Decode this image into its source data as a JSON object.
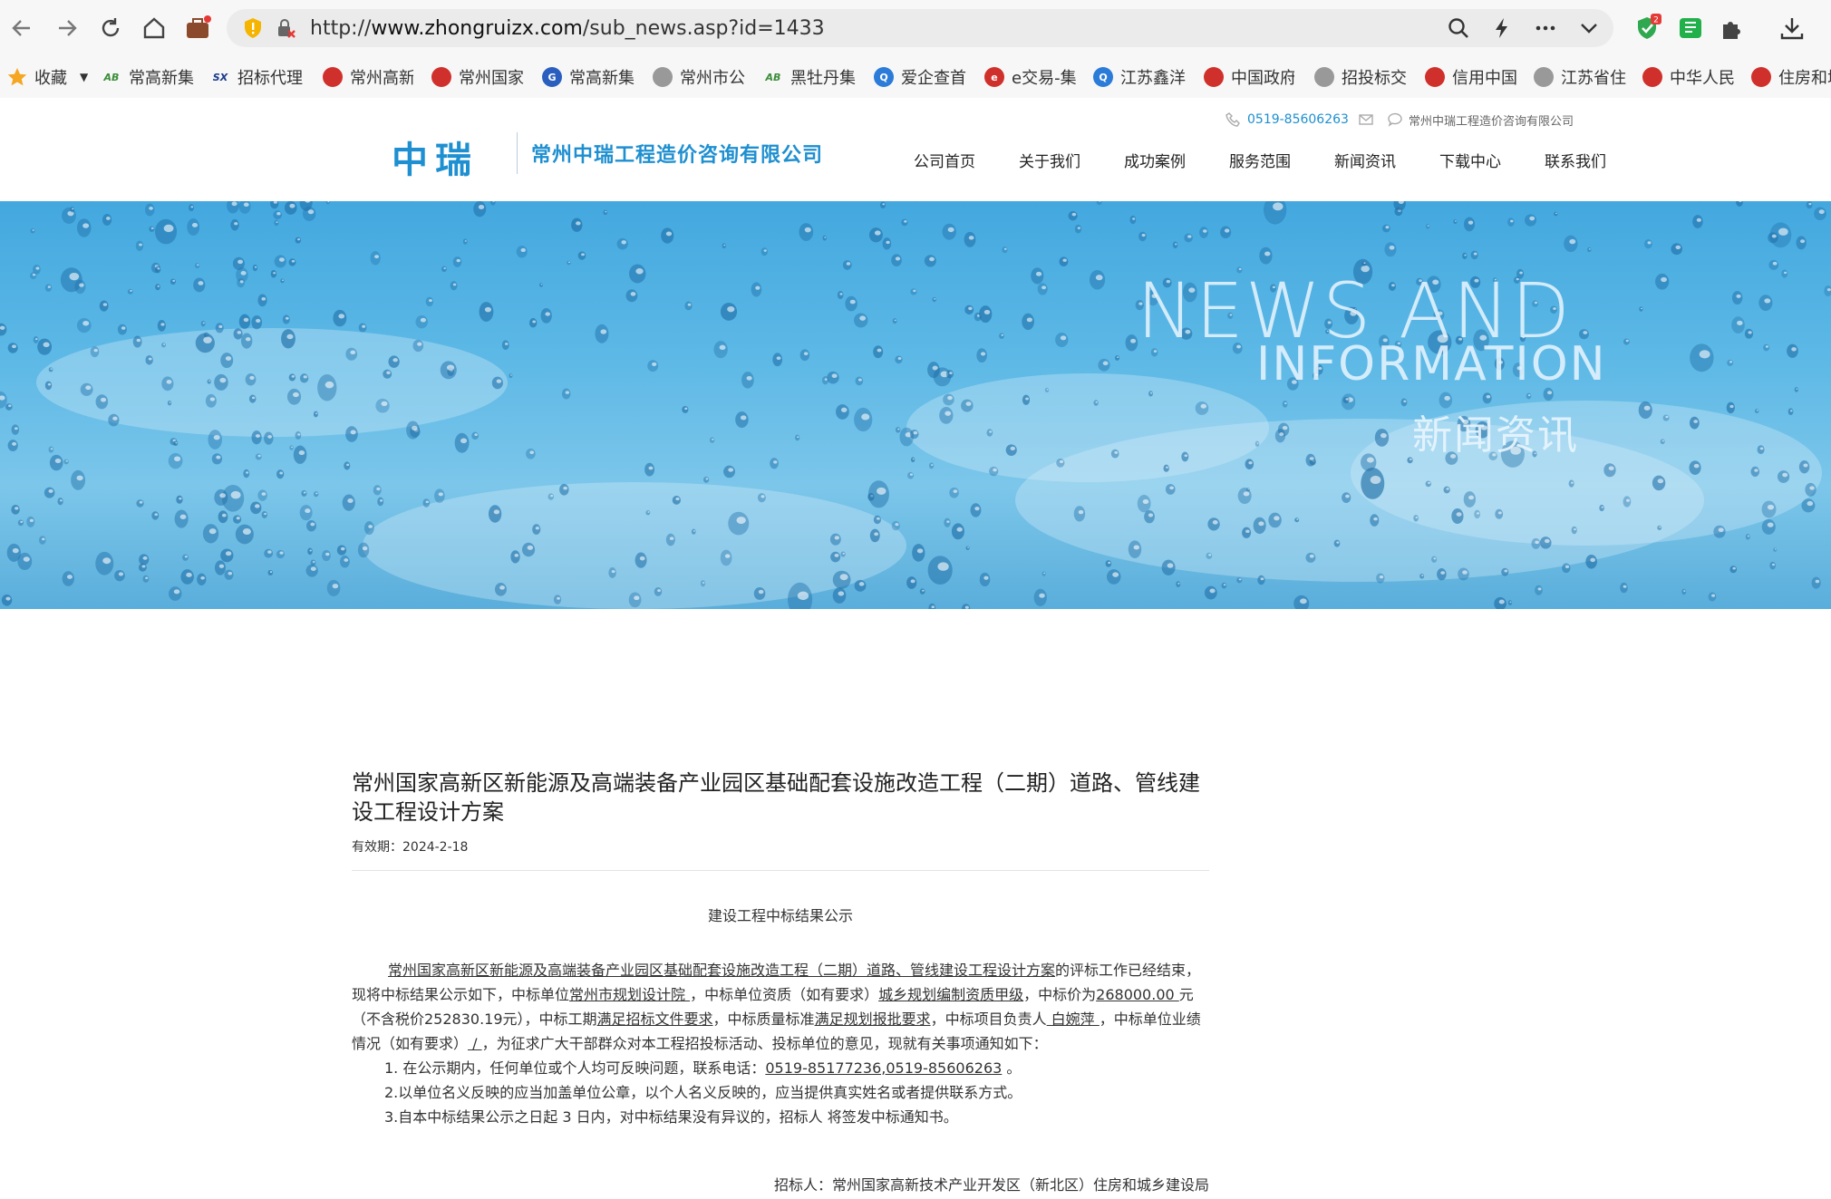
{
  "browser": {
    "url_scheme": "http://",
    "url_host": "www.zhongruizx.com",
    "url_path": "/sub_news.asp?id=1433",
    "extension_badge": "2"
  },
  "bookmarks": [
    {
      "label": "收藏",
      "icon": "star-icon",
      "color": "#f5a623"
    },
    {
      "label": "常高新集",
      "icon": "ab-icon",
      "color": "#3a8d3a"
    },
    {
      "label": "招标代理",
      "icon": "sx-icon",
      "color": "#1b3a8c"
    },
    {
      "label": "常州高新",
      "icon": "seal-icon",
      "color": "#d0302b"
    },
    {
      "label": "常州国家",
      "icon": "emblem-icon",
      "color": "#d0302b"
    },
    {
      "label": "常高新集",
      "icon": "g-icon",
      "color": "#2b5fbf"
    },
    {
      "label": "常州市公",
      "icon": "globe-icon",
      "color": "#888888"
    },
    {
      "label": "黑牡丹集",
      "icon": "ab-icon",
      "color": "#3a8d3a"
    },
    {
      "label": "爱企查首",
      "icon": "q-icon",
      "color": "#2b7bd9"
    },
    {
      "label": "e交易-集",
      "icon": "e-icon",
      "color": "#d0302b"
    },
    {
      "label": "江苏鑫洋",
      "icon": "q-icon",
      "color": "#2b7bd9"
    },
    {
      "label": "中国政府",
      "icon": "emblem-icon",
      "color": "#d0302b"
    },
    {
      "label": "招投标交",
      "icon": "globe-icon",
      "color": "#888888"
    },
    {
      "label": "信用中国",
      "icon": "emblem-icon",
      "color": "#d0302b"
    },
    {
      "label": "江苏省住",
      "icon": "globe-icon",
      "color": "#888888"
    },
    {
      "label": "中华人民",
      "icon": "emblem-icon",
      "color": "#d0302b"
    },
    {
      "label": "住房和城",
      "icon": "emblem-icon",
      "color": "#d0302b"
    }
  ],
  "site": {
    "logo_text": "中瑞",
    "company_name": "常州中瑞工程造价咨询有限公司",
    "phone": "0519-85606263",
    "contact_company": "常州中瑞工程造价咨询有限公司",
    "accent_color": "#1e8fd0",
    "nav": [
      "公司首页",
      "关于我们",
      "成功案例",
      "服务范围",
      "新闻资讯",
      "下载中心",
      "联系我们"
    ]
  },
  "banner": {
    "title_line1": "NEWS AND",
    "title_line2": "INFORMATION",
    "title_cn": "新闻资讯"
  },
  "article": {
    "title": "常州国家高新区新能源及高端装备产业园区基础配套设施改造工程（二期）道路、管线建设工程设计方案",
    "date": "有效期：2024-2-18",
    "notice_heading": "建设工程中标结果公示",
    "body": {
      "project_name": "常州国家高新区新能源及高端装备产业园区基础配套设施改造工程（二期）道路、管线建设工程设计方案",
      "t1": "的评标工作已经结束，现将中标结果公示如下，中标单位",
      "winner": "常州市规划设计院 ",
      "t2": "，中标单位资质（如有要求）",
      "qualification": "城乡规划编制资质甲级",
      "t3": "，中标价为",
      "price": "268000.00 ",
      "t4": "元（不含税价252830.19元），中标工期",
      "duration": "满足招标文件要求",
      "t5": "，中标质量标准",
      "quality": "满足规划报批要求",
      "t6": "，中标项目负责人",
      "manager": " 白婉萍 ",
      "t7": "，中标单位业绩情况（如有要求）",
      "performance": " / ",
      "t8": "，为征求广大干部群众对本工程招投标活动、投标单位的意见，现就有关事项通知如下："
    },
    "item1_prefix": "1. 在公示期内，任何单位或个人均可反映问题，联系电话：",
    "item1_phone": "0519-85177236,0519-85606263",
    "item1_suffix": " 。",
    "item2": "2.以单位名义反映的应当加盖单位公章，以个人名义反映的，应当提供真实姓名或者提供联系方式。",
    "item3": "3.自本中标结果公示之日起 3 日内，对中标结果没有异议的，招标人 将签发中标通知书。",
    "tenderer": "招标人：常州国家高新技术产业开发区（新北区）住房和城乡建设局"
  }
}
